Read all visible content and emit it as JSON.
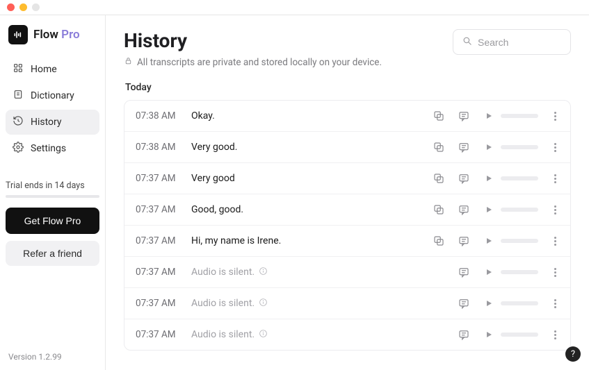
{
  "brand": {
    "name": "Flow",
    "suffix": "Pro"
  },
  "sidebar": {
    "items": [
      "Home",
      "Dictionary",
      "History",
      "Settings"
    ],
    "activeIndex": 2,
    "trial_label": "Trial ends in 14 days",
    "cta_label": "Get Flow Pro",
    "refer_label": "Refer a friend"
  },
  "version_label": "Version 1.2.99",
  "header": {
    "title": "History",
    "privacy_text": "All transcripts are private and stored locally on your device.",
    "search_placeholder": "Search"
  },
  "section_label": "Today",
  "silent_text": "Audio is silent.",
  "rows": [
    {
      "time": "07:38 AM",
      "text": "Okay.",
      "silent": false
    },
    {
      "time": "07:38 AM",
      "text": "Very good.",
      "silent": false
    },
    {
      "time": "07:37 AM",
      "text": "Very good",
      "silent": false
    },
    {
      "time": "07:37 AM",
      "text": "Good, good.",
      "silent": false
    },
    {
      "time": "07:37 AM",
      "text": "Hi, my name is Irene.",
      "silent": false
    },
    {
      "time": "07:37 AM",
      "text": "",
      "silent": true
    },
    {
      "time": "07:37 AM",
      "text": "",
      "silent": true
    },
    {
      "time": "07:37 AM",
      "text": "",
      "silent": true
    }
  ]
}
